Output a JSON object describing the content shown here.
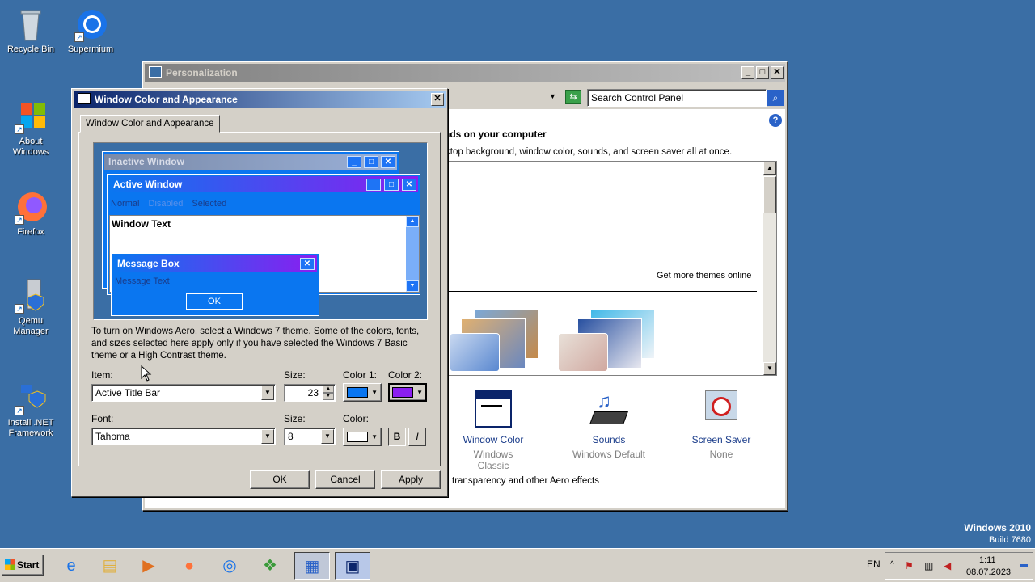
{
  "desktop": {
    "icons": [
      {
        "label": "Recycle Bin"
      },
      {
        "label": "Supermium"
      },
      {
        "label": "About Windows"
      },
      {
        "label": "Firefox"
      },
      {
        "label": "Qemu Manager"
      },
      {
        "label": "Install .NET Framework"
      }
    ],
    "brand_title": "Windows 2010",
    "brand_build": "Build 7680"
  },
  "personalization": {
    "title": "Personalization",
    "search_placeholder": "Search Control Panel",
    "heading": "nds on your computer",
    "subtext": "ktop background, window color, sounds, and screen saver all at once.",
    "more_themes": "Get more themes online",
    "items": [
      {
        "label": "Window Color",
        "sub": "Windows Classic"
      },
      {
        "label": "Sounds",
        "sub": "Windows Default"
      },
      {
        "label": "Screen Saver",
        "sub": "None"
      }
    ],
    "aero_link": "transparency and other Aero effects"
  },
  "dialog": {
    "title": "Window Color and Appearance",
    "tab": "Window Color and Appearance",
    "preview": {
      "inactive_title": "Inactive Window",
      "active_title": "Active Window",
      "menu_normal": "Normal",
      "menu_disabled": "Disabled",
      "menu_selected": "Selected",
      "window_text": "Window Text",
      "msgbox_title": "Message Box",
      "msgbox_text": "Message Text",
      "msgbox_ok": "OK"
    },
    "info": "To turn on Windows Aero, select a Windows 7 theme.  Some of the colors, fonts, and sizes selected here apply only if you have selected the Windows 7 Basic theme or a High Contrast theme.",
    "item_label": "Item:",
    "item_value": "Active Title Bar",
    "size_label": "Size:",
    "size_value": "23",
    "color1_label": "Color 1:",
    "color1": "#0a76f0",
    "color2_label": "Color 2:",
    "color2": "#8a1ef0",
    "font_label": "Font:",
    "font_value": "Tahoma",
    "font_size_label": "Size:",
    "font_size_value": "8",
    "font_color_label": "Color:",
    "font_color": "#ffffff",
    "bold": "B",
    "italic": "I",
    "ok": "OK",
    "cancel": "Cancel",
    "apply": "Apply"
  },
  "taskbar": {
    "start": "Start",
    "lang": "EN",
    "time": "1:11",
    "date": "08.07.2023"
  },
  "colors": {
    "desktop": "#3a6ea5",
    "active_gradient_start": "#0a246a",
    "active_gradient_end": "#a6caf0"
  }
}
